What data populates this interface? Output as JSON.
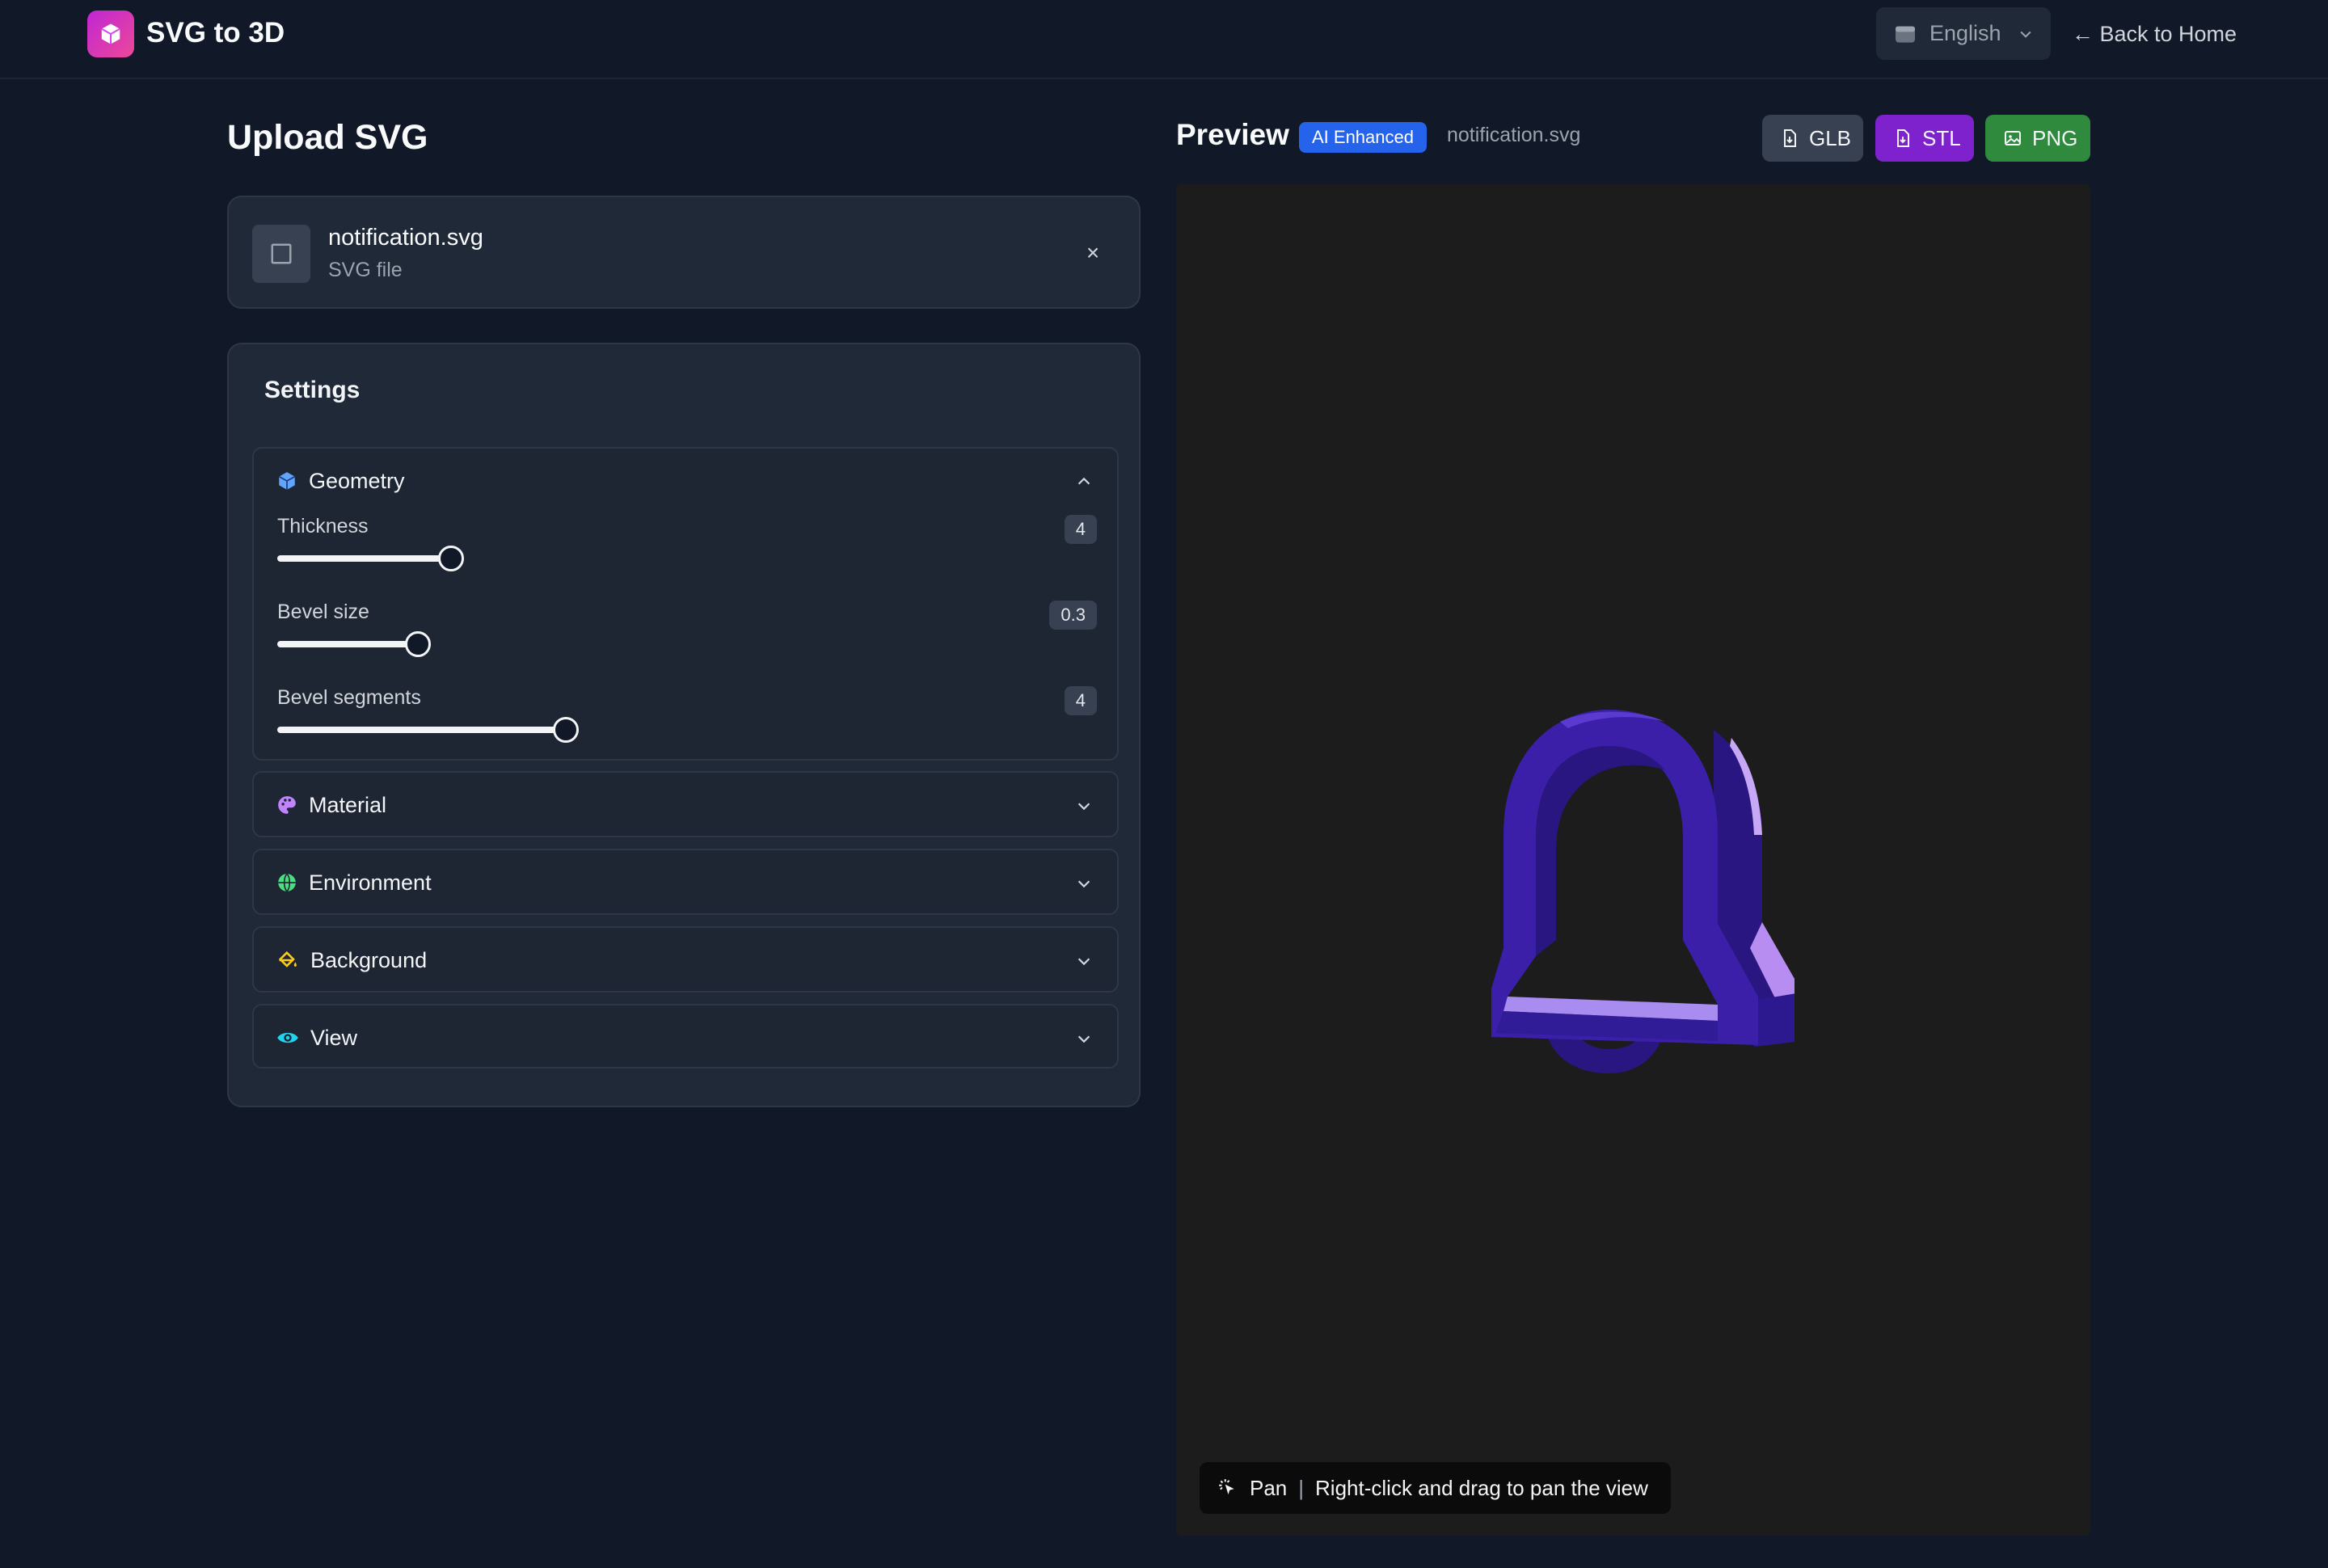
{
  "header": {
    "app_title": "SVG to 3D",
    "language": "English",
    "back_label": "← Back to Home"
  },
  "upload": {
    "title": "Upload SVG",
    "file_name": "notification.svg",
    "file_type": "SVG file",
    "close_label": "×"
  },
  "settings": {
    "title": "Settings",
    "geometry": {
      "label": "Geometry",
      "sliders": [
        {
          "label": "Thickness",
          "value": "4",
          "fraction": 0.21
        },
        {
          "label": "Bevel size",
          "value": "0.3",
          "fraction": 0.17
        },
        {
          "label": "Bevel segments",
          "value": "4",
          "fraction": 0.35
        }
      ]
    },
    "sections": [
      {
        "label": "Material",
        "icon": "palette-icon",
        "color": "#c084fc"
      },
      {
        "label": "Environment",
        "icon": "globe-icon",
        "color": "#4ade80"
      },
      {
        "label": "Background",
        "icon": "paint-bucket-icon",
        "color": "#facc15"
      },
      {
        "label": "View",
        "icon": "eye-icon",
        "color": "#22d3ee"
      }
    ]
  },
  "preview": {
    "title": "Preview",
    "badge": "AI Enhanced",
    "file_name": "notification.svg",
    "exports": {
      "glb": "GLB",
      "stl": "STL",
      "png": "PNG"
    },
    "hint_mode": "Pan",
    "hint_sep": "|",
    "hint_text": "Right-click and drag to pan the view"
  },
  "colors": {
    "accent_blue": "#2563eb",
    "stl_purple": "#7e22ce",
    "png_green": "#2f8a3e",
    "model_indigo": "#3b1fa8"
  }
}
